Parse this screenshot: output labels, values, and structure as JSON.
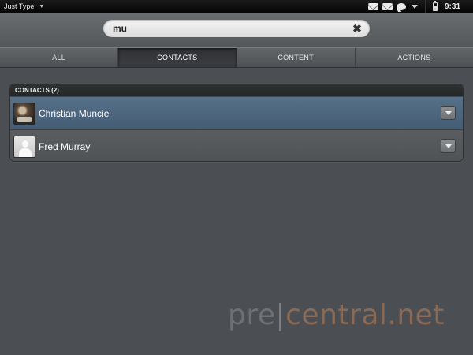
{
  "statusbar": {
    "app_menu_label": "Just Type",
    "time": "9:31"
  },
  "search": {
    "query": "mu"
  },
  "tabs": [
    {
      "label": "ALL",
      "active": false
    },
    {
      "label": "CONTACTS",
      "active": true
    },
    {
      "label": "CONTENT",
      "active": false
    },
    {
      "label": "ACTIONS",
      "active": false
    }
  ],
  "contacts": {
    "header": "CONTACTS (2)",
    "items": [
      {
        "prefix": "Christian ",
        "match": "Mu",
        "suffix": "ncie",
        "selected": true
      },
      {
        "prefix": "Fred ",
        "match": "Mu",
        "suffix": "rray",
        "selected": false
      }
    ]
  },
  "watermark": {
    "pre": "pre",
    "bar": "|",
    "site": "central.net"
  },
  "colors": {
    "background": "#4b4e52",
    "selected_row": "#4f6880",
    "match_underline": "#4fb3ff",
    "watermark_site": "#8a6a55"
  }
}
